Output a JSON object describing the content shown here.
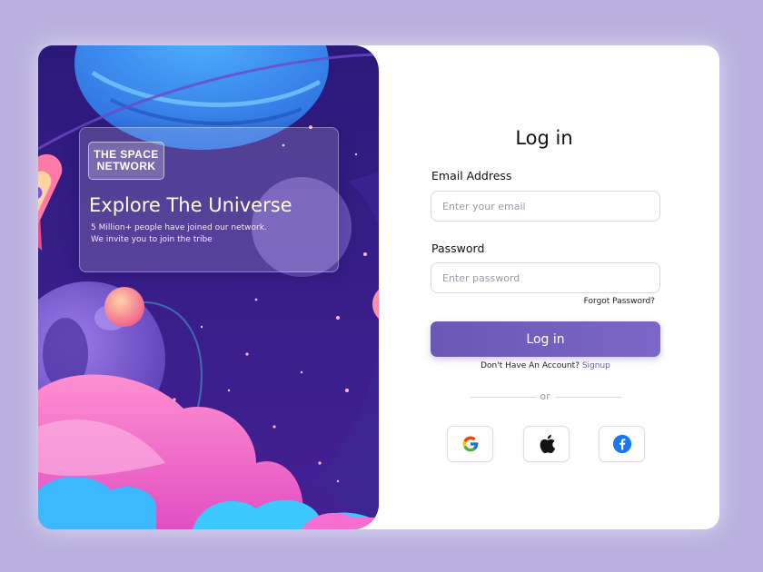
{
  "hero": {
    "brand_line1": "THE SPACE",
    "brand_line2": "NETWORK",
    "title": "Explore The Universe",
    "line1": "5 Million+ people have joined our network.",
    "line2": "We invite you to join the tribe"
  },
  "form": {
    "title": "Log in",
    "email_label": "Email Address",
    "email_placeholder": "Enter your email",
    "password_label": "Password",
    "password_placeholder": "Enter password",
    "forgot": "Forgot Password?",
    "submit": "Log in",
    "no_account": "Don't Have An Account?",
    "signup": "Signup",
    "or": "or"
  },
  "social": [
    {
      "icon": "google-icon"
    },
    {
      "icon": "apple-icon"
    },
    {
      "icon": "facebook-icon"
    }
  ],
  "colors": {
    "page_bg": "#b9b0df",
    "accent": "#6a58b4",
    "facebook": "#1877f2"
  }
}
